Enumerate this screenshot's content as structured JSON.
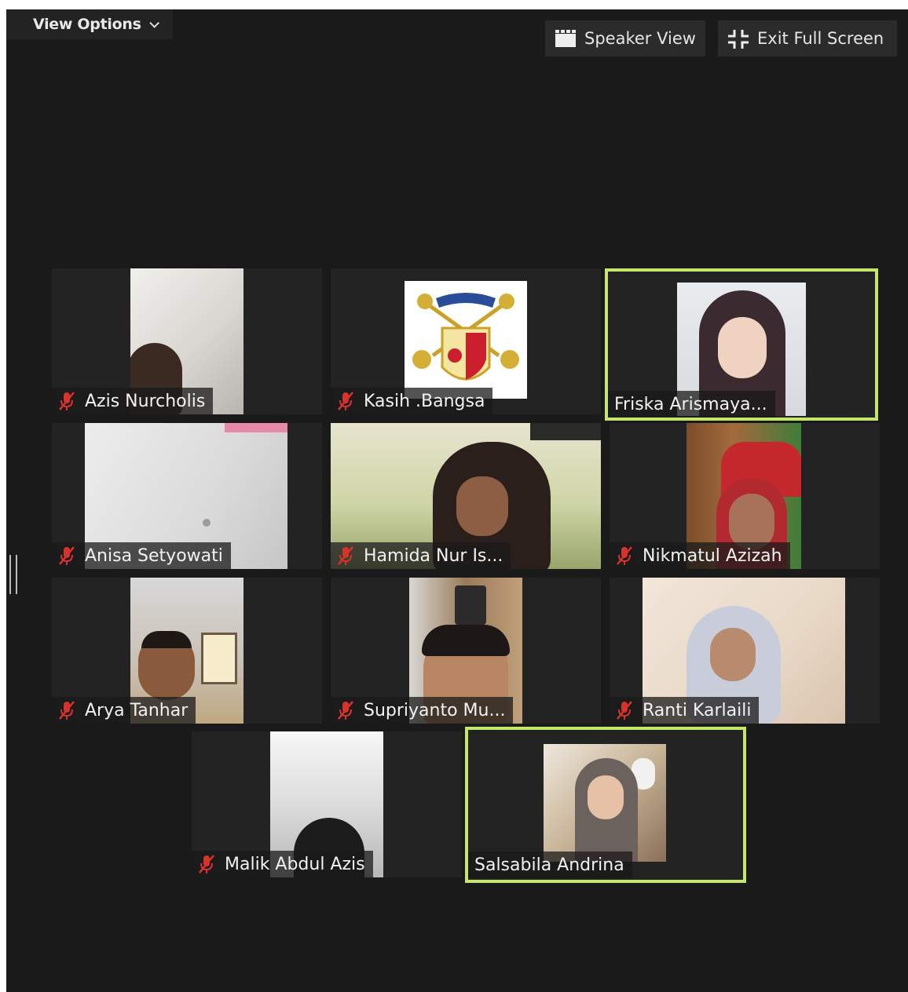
{
  "toolbar": {
    "view_options_label": "View Options",
    "speaker_view_label": "Speaker View",
    "exit_full_screen_label": "Exit Full Screen"
  },
  "colors": {
    "background": "#1a1a1a",
    "tile": "#232323",
    "active_speaker_border": "#c4e66a",
    "muted_mic": "#d8332a"
  },
  "participants": [
    {
      "name": "Azis Nurcholis",
      "muted": true
    },
    {
      "name": "Kasih .Bangsa",
      "muted": true
    },
    {
      "name": "Friska Arismaya...",
      "muted": false,
      "active": true
    },
    {
      "name": "Anisa Setyowati",
      "muted": true
    },
    {
      "name": "Hamida Nur Is...",
      "muted": true
    },
    {
      "name": "Nikmatul Azizah",
      "muted": true
    },
    {
      "name": "Arya Tanhar",
      "muted": true
    },
    {
      "name": "Supriyanto Mu...",
      "muted": true
    },
    {
      "name": "Ranti Karlaili",
      "muted": true
    },
    {
      "name": "Malik Abdul Azis",
      "muted": true
    },
    {
      "name": "Salsabila Andrina",
      "muted": false,
      "active": true
    }
  ]
}
